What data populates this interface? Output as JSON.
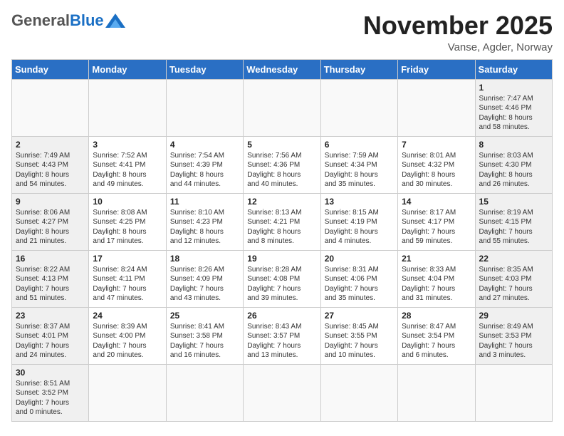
{
  "logo": {
    "general": "General",
    "blue": "Blue"
  },
  "title": "November 2025",
  "location": "Vanse, Agder, Norway",
  "days_of_week": [
    "Sunday",
    "Monday",
    "Tuesday",
    "Wednesday",
    "Thursday",
    "Friday",
    "Saturday"
  ],
  "weeks": [
    [
      {
        "day": "",
        "info": ""
      },
      {
        "day": "",
        "info": ""
      },
      {
        "day": "",
        "info": ""
      },
      {
        "day": "",
        "info": ""
      },
      {
        "day": "",
        "info": ""
      },
      {
        "day": "",
        "info": ""
      },
      {
        "day": "1",
        "info": "Sunrise: 7:47 AM\nSunset: 4:46 PM\nDaylight: 8 hours\nand 58 minutes."
      }
    ],
    [
      {
        "day": "2",
        "info": "Sunrise: 7:49 AM\nSunset: 4:43 PM\nDaylight: 8 hours\nand 54 minutes."
      },
      {
        "day": "3",
        "info": "Sunrise: 7:52 AM\nSunset: 4:41 PM\nDaylight: 8 hours\nand 49 minutes."
      },
      {
        "day": "4",
        "info": "Sunrise: 7:54 AM\nSunset: 4:39 PM\nDaylight: 8 hours\nand 44 minutes."
      },
      {
        "day": "5",
        "info": "Sunrise: 7:56 AM\nSunset: 4:36 PM\nDaylight: 8 hours\nand 40 minutes."
      },
      {
        "day": "6",
        "info": "Sunrise: 7:59 AM\nSunset: 4:34 PM\nDaylight: 8 hours\nand 35 minutes."
      },
      {
        "day": "7",
        "info": "Sunrise: 8:01 AM\nSunset: 4:32 PM\nDaylight: 8 hours\nand 30 minutes."
      },
      {
        "day": "8",
        "info": "Sunrise: 8:03 AM\nSunset: 4:30 PM\nDaylight: 8 hours\nand 26 minutes."
      }
    ],
    [
      {
        "day": "9",
        "info": "Sunrise: 8:06 AM\nSunset: 4:27 PM\nDaylight: 8 hours\nand 21 minutes."
      },
      {
        "day": "10",
        "info": "Sunrise: 8:08 AM\nSunset: 4:25 PM\nDaylight: 8 hours\nand 17 minutes."
      },
      {
        "day": "11",
        "info": "Sunrise: 8:10 AM\nSunset: 4:23 PM\nDaylight: 8 hours\nand 12 minutes."
      },
      {
        "day": "12",
        "info": "Sunrise: 8:13 AM\nSunset: 4:21 PM\nDaylight: 8 hours\nand 8 minutes."
      },
      {
        "day": "13",
        "info": "Sunrise: 8:15 AM\nSunset: 4:19 PM\nDaylight: 8 hours\nand 4 minutes."
      },
      {
        "day": "14",
        "info": "Sunrise: 8:17 AM\nSunset: 4:17 PM\nDaylight: 7 hours\nand 59 minutes."
      },
      {
        "day": "15",
        "info": "Sunrise: 8:19 AM\nSunset: 4:15 PM\nDaylight: 7 hours\nand 55 minutes."
      }
    ],
    [
      {
        "day": "16",
        "info": "Sunrise: 8:22 AM\nSunset: 4:13 PM\nDaylight: 7 hours\nand 51 minutes."
      },
      {
        "day": "17",
        "info": "Sunrise: 8:24 AM\nSunset: 4:11 PM\nDaylight: 7 hours\nand 47 minutes."
      },
      {
        "day": "18",
        "info": "Sunrise: 8:26 AM\nSunset: 4:09 PM\nDaylight: 7 hours\nand 43 minutes."
      },
      {
        "day": "19",
        "info": "Sunrise: 8:28 AM\nSunset: 4:08 PM\nDaylight: 7 hours\nand 39 minutes."
      },
      {
        "day": "20",
        "info": "Sunrise: 8:31 AM\nSunset: 4:06 PM\nDaylight: 7 hours\nand 35 minutes."
      },
      {
        "day": "21",
        "info": "Sunrise: 8:33 AM\nSunset: 4:04 PM\nDaylight: 7 hours\nand 31 minutes."
      },
      {
        "day": "22",
        "info": "Sunrise: 8:35 AM\nSunset: 4:03 PM\nDaylight: 7 hours\nand 27 minutes."
      }
    ],
    [
      {
        "day": "23",
        "info": "Sunrise: 8:37 AM\nSunset: 4:01 PM\nDaylight: 7 hours\nand 24 minutes."
      },
      {
        "day": "24",
        "info": "Sunrise: 8:39 AM\nSunset: 4:00 PM\nDaylight: 7 hours\nand 20 minutes."
      },
      {
        "day": "25",
        "info": "Sunrise: 8:41 AM\nSunset: 3:58 PM\nDaylight: 7 hours\nand 16 minutes."
      },
      {
        "day": "26",
        "info": "Sunrise: 8:43 AM\nSunset: 3:57 PM\nDaylight: 7 hours\nand 13 minutes."
      },
      {
        "day": "27",
        "info": "Sunrise: 8:45 AM\nSunset: 3:55 PM\nDaylight: 7 hours\nand 10 minutes."
      },
      {
        "day": "28",
        "info": "Sunrise: 8:47 AM\nSunset: 3:54 PM\nDaylight: 7 hours\nand 6 minutes."
      },
      {
        "day": "29",
        "info": "Sunrise: 8:49 AM\nSunset: 3:53 PM\nDaylight: 7 hours\nand 3 minutes."
      }
    ],
    [
      {
        "day": "30",
        "info": "Sunrise: 8:51 AM\nSunset: 3:52 PM\nDaylight: 7 hours\nand 0 minutes."
      },
      {
        "day": "",
        "info": ""
      },
      {
        "day": "",
        "info": ""
      },
      {
        "day": "",
        "info": ""
      },
      {
        "day": "",
        "info": ""
      },
      {
        "day": "",
        "info": ""
      },
      {
        "day": "",
        "info": ""
      }
    ]
  ]
}
